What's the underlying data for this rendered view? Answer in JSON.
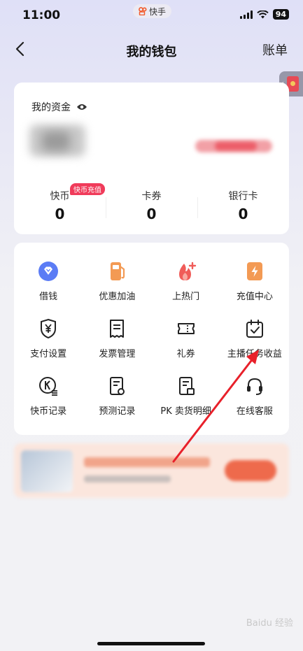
{
  "status_bar": {
    "time": "11:00",
    "app_name": "快手",
    "battery": "94"
  },
  "nav": {
    "title": "我的钱包",
    "bill_label": "账单"
  },
  "balance": {
    "label": "我的资金",
    "stats": [
      {
        "label": "快币",
        "value": "0",
        "badge": "快币充值"
      },
      {
        "label": "卡券",
        "value": "0"
      },
      {
        "label": "银行卡",
        "value": "0"
      }
    ]
  },
  "menu": {
    "items": [
      {
        "label": "借钱",
        "icon": "diamond-icon"
      },
      {
        "label": "优惠加油",
        "icon": "gas-pump-icon"
      },
      {
        "label": "上热门",
        "icon": "flame-plus-icon"
      },
      {
        "label": "充值中心",
        "icon": "lightning-icon"
      },
      {
        "label": "支付设置",
        "icon": "yen-shield-icon"
      },
      {
        "label": "发票管理",
        "icon": "invoice-icon"
      },
      {
        "label": "礼券",
        "icon": "ticket-icon"
      },
      {
        "label": "主播任务收益",
        "icon": "calendar-check-icon"
      },
      {
        "label": "快币记录",
        "icon": "coin-record-icon"
      },
      {
        "label": "预测记录",
        "icon": "document-icon"
      },
      {
        "label": "PK 卖货明细",
        "icon": "list-doc-icon"
      },
      {
        "label": "在线客服",
        "icon": "headset-icon"
      }
    ]
  },
  "watermark": "Baidu 经验",
  "colors": {
    "accent_red": "#f03b5a",
    "orange": "#f39a54",
    "blue": "#5b7cf5",
    "annotation_arrow": "#e8202a"
  }
}
